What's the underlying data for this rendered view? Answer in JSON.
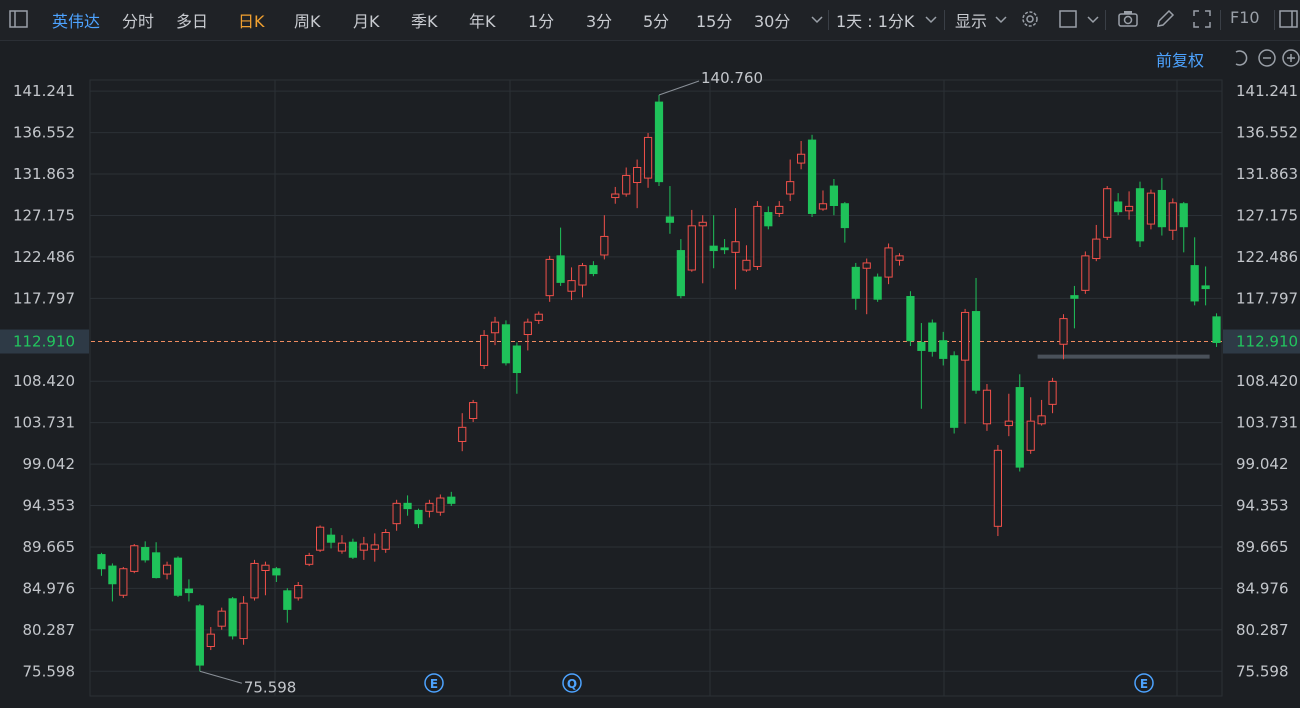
{
  "toolbar": {
    "stock_name": "英伟达",
    "periods": [
      "分时",
      "多日",
      "日K",
      "周K",
      "月K",
      "季K",
      "年K",
      "1分",
      "3分",
      "5分",
      "15分",
      "30分"
    ],
    "active_period": "日K",
    "combo_label": "1天 : 1分K",
    "display_label": "显示",
    "f10_label": "F10",
    "adjust_label": "前复权"
  },
  "colors": {
    "up": "#f0504a",
    "down": "#1fc25a",
    "price_line": "#f08c60",
    "grid": "#2b3036",
    "price_box": "#2e3a46",
    "price_text": "#22c55e"
  },
  "icons": [
    "chevron-down-icon",
    "settings-icon",
    "square-icon",
    "camera-icon",
    "pencil-icon",
    "fullscreen-icon",
    "sidebar-toggle-icon",
    "undo-icon",
    "zoom-out-icon",
    "zoom-in-icon"
  ],
  "chart_data": {
    "type": "candlestick",
    "ylim": [
      72.8,
      142.5
    ],
    "y_ticks": [
      "141.241",
      "136.552",
      "131.863",
      "127.175",
      "122.486",
      "117.797",
      "112.910",
      "108.420",
      "103.731",
      "99.042",
      "94.353",
      "89.665",
      "84.976",
      "80.287",
      "75.598"
    ],
    "current_price": "112.910",
    "high_label": "140.760",
    "low_label": "75.598",
    "event_markers": [
      "E",
      "Q",
      "E"
    ],
    "candles": [
      {
        "o": 88.8,
        "c": 87.2,
        "h": 89.0,
        "l": 86.4
      },
      {
        "o": 87.5,
        "c": 85.5,
        "h": 87.8,
        "l": 83.5
      },
      {
        "o": 84.2,
        "c": 87.2,
        "h": 87.4,
        "l": 83.9
      },
      {
        "o": 86.9,
        "c": 89.8,
        "h": 90.0,
        "l": 86.7
      },
      {
        "o": 89.6,
        "c": 88.2,
        "h": 90.3,
        "l": 87.9
      },
      {
        "o": 89.0,
        "c": 86.2,
        "h": 90.2,
        "l": 86.1
      },
      {
        "o": 86.6,
        "c": 87.6,
        "h": 88.0,
        "l": 86.0
      },
      {
        "o": 88.4,
        "c": 84.2,
        "h": 88.6,
        "l": 84.0
      },
      {
        "o": 84.9,
        "c": 84.5,
        "h": 86.0,
        "l": 83.5
      },
      {
        "o": 83.0,
        "c": 76.3,
        "h": 83.2,
        "l": 75.6
      },
      {
        "o": 78.4,
        "c": 79.8,
        "h": 80.6,
        "l": 78.0
      },
      {
        "o": 80.7,
        "c": 82.4,
        "h": 82.8,
        "l": 80.3
      },
      {
        "o": 83.8,
        "c": 79.6,
        "h": 84.0,
        "l": 79.2
      },
      {
        "o": 79.3,
        "c": 83.3,
        "h": 84.1,
        "l": 78.6
      },
      {
        "o": 83.9,
        "c": 87.8,
        "h": 88.2,
        "l": 83.6
      },
      {
        "o": 87.0,
        "c": 87.6,
        "h": 88.0,
        "l": 84.2
      },
      {
        "o": 87.2,
        "c": 86.5,
        "h": 87.4,
        "l": 85.7
      },
      {
        "o": 84.7,
        "c": 82.6,
        "h": 85.0,
        "l": 81.1
      },
      {
        "o": 83.9,
        "c": 85.3,
        "h": 85.7,
        "l": 83.6
      },
      {
        "o": 87.7,
        "c": 88.7,
        "h": 89.0,
        "l": 87.5
      },
      {
        "o": 89.3,
        "c": 91.9,
        "h": 92.1,
        "l": 89.1
      },
      {
        "o": 91.0,
        "c": 90.2,
        "h": 91.8,
        "l": 89.5
      },
      {
        "o": 89.2,
        "c": 90.1,
        "h": 91.0,
        "l": 88.9
      },
      {
        "o": 90.2,
        "c": 88.5,
        "h": 90.6,
        "l": 88.3
      },
      {
        "o": 89.3,
        "c": 90.0,
        "h": 90.8,
        "l": 88.2
      },
      {
        "o": 89.4,
        "c": 89.9,
        "h": 91.2,
        "l": 88.0
      },
      {
        "o": 89.4,
        "c": 91.3,
        "h": 91.7,
        "l": 89.0
      },
      {
        "o": 92.3,
        "c": 94.6,
        "h": 95.0,
        "l": 91.5
      },
      {
        "o": 94.6,
        "c": 94.0,
        "h": 95.5,
        "l": 93.2
      },
      {
        "o": 93.8,
        "c": 92.3,
        "h": 94.0,
        "l": 91.8
      },
      {
        "o": 93.7,
        "c": 94.6,
        "h": 95.0,
        "l": 93.0
      },
      {
        "o": 93.6,
        "c": 95.2,
        "h": 95.6,
        "l": 93.2
      },
      {
        "o": 95.3,
        "c": 94.6,
        "h": 95.9,
        "l": 94.3
      },
      {
        "o": 101.6,
        "c": 103.2,
        "h": 104.8,
        "l": 100.5
      },
      {
        "o": 104.2,
        "c": 106.0,
        "h": 106.3,
        "l": 103.8
      },
      {
        "o": 110.2,
        "c": 113.6,
        "h": 114.2,
        "l": 109.8
      },
      {
        "o": 113.9,
        "c": 115.1,
        "h": 115.7,
        "l": 112.5
      },
      {
        "o": 114.8,
        "c": 110.5,
        "h": 115.3,
        "l": 110.2
      },
      {
        "o": 112.4,
        "c": 109.4,
        "h": 112.8,
        "l": 107.0
      },
      {
        "o": 113.7,
        "c": 115.1,
        "h": 115.5,
        "l": 111.9
      },
      {
        "o": 115.3,
        "c": 116.0,
        "h": 116.3,
        "l": 114.9
      },
      {
        "o": 118.1,
        "c": 122.2,
        "h": 122.6,
        "l": 117.4
      },
      {
        "o": 122.6,
        "c": 119.6,
        "h": 125.8,
        "l": 119.2
      },
      {
        "o": 118.6,
        "c": 119.8,
        "h": 121.3,
        "l": 117.6
      },
      {
        "o": 119.3,
        "c": 121.5,
        "h": 121.8,
        "l": 117.9
      },
      {
        "o": 121.5,
        "c": 120.6,
        "h": 122.0,
        "l": 120.3
      },
      {
        "o": 122.7,
        "c": 124.8,
        "h": 127.2,
        "l": 122.2
      },
      {
        "o": 129.2,
        "c": 129.6,
        "h": 130.4,
        "l": 128.5
      },
      {
        "o": 129.6,
        "c": 131.7,
        "h": 132.6,
        "l": 129.3
      },
      {
        "o": 130.9,
        "c": 132.6,
        "h": 133.5,
        "l": 128.0
      },
      {
        "o": 131.4,
        "c": 136.0,
        "h": 136.5,
        "l": 130.3
      },
      {
        "o": 140.0,
        "c": 131.0,
        "h": 140.8,
        "l": 130.5
      },
      {
        "o": 127.0,
        "c": 126.4,
        "h": 130.5,
        "l": 125.1
      },
      {
        "o": 123.2,
        "c": 118.1,
        "h": 124.5,
        "l": 117.8
      },
      {
        "o": 121.0,
        "c": 126.0,
        "h": 127.8,
        "l": 120.8
      },
      {
        "o": 126.0,
        "c": 126.4,
        "h": 127.2,
        "l": 119.5
      },
      {
        "o": 123.7,
        "c": 123.2,
        "h": 127.2,
        "l": 121.2
      },
      {
        "o": 123.5,
        "c": 123.3,
        "h": 124.5,
        "l": 122.8
      },
      {
        "o": 123.0,
        "c": 124.2,
        "h": 128.0,
        "l": 118.8
      },
      {
        "o": 121.0,
        "c": 122.1,
        "h": 123.8,
        "l": 120.8
      },
      {
        "o": 121.4,
        "c": 128.2,
        "h": 128.8,
        "l": 121.0
      },
      {
        "o": 127.5,
        "c": 126.0,
        "h": 128.2,
        "l": 125.6
      },
      {
        "o": 127.4,
        "c": 128.2,
        "h": 128.8,
        "l": 127.0
      },
      {
        "o": 129.6,
        "c": 131.0,
        "h": 133.5,
        "l": 128.8
      },
      {
        "o": 133.1,
        "c": 134.1,
        "h": 135.6,
        "l": 132.4
      },
      {
        "o": 135.7,
        "c": 127.4,
        "h": 136.3,
        "l": 127.0
      },
      {
        "o": 127.9,
        "c": 128.5,
        "h": 130.0,
        "l": 127.7
      },
      {
        "o": 130.5,
        "c": 128.3,
        "h": 131.3,
        "l": 127.2
      },
      {
        "o": 128.5,
        "c": 125.8,
        "h": 128.7,
        "l": 124.1
      },
      {
        "o": 121.3,
        "c": 117.8,
        "h": 121.8,
        "l": 116.5
      },
      {
        "o": 121.2,
        "c": 121.8,
        "h": 122.3,
        "l": 116.0
      },
      {
        "o": 120.2,
        "c": 117.7,
        "h": 120.6,
        "l": 117.4
      },
      {
        "o": 120.2,
        "c": 123.5,
        "h": 124.0,
        "l": 119.4
      },
      {
        "o": 122.1,
        "c": 122.6,
        "h": 122.9,
        "l": 121.5
      },
      {
        "o": 118.0,
        "c": 113.0,
        "h": 118.6,
        "l": 112.4
      },
      {
        "o": 112.8,
        "c": 111.9,
        "h": 115.0,
        "l": 105.3
      },
      {
        "o": 115.0,
        "c": 111.8,
        "h": 115.4,
        "l": 111.2
      },
      {
        "o": 113.0,
        "c": 111.0,
        "h": 114.0,
        "l": 110.2
      },
      {
        "o": 111.3,
        "c": 103.2,
        "h": 111.8,
        "l": 102.5
      },
      {
        "o": 110.8,
        "c": 116.2,
        "h": 116.6,
        "l": 103.6
      },
      {
        "o": 116.3,
        "c": 107.4,
        "h": 120.1,
        "l": 107.0
      },
      {
        "o": 103.6,
        "c": 107.4,
        "h": 108.1,
        "l": 102.8
      },
      {
        "o": 92.0,
        "c": 100.6,
        "h": 101.2,
        "l": 90.9
      },
      {
        "o": 103.4,
        "c": 103.9,
        "h": 107.0,
        "l": 102.2
      },
      {
        "o": 107.7,
        "c": 98.7,
        "h": 109.2,
        "l": 98.2
      },
      {
        "o": 100.6,
        "c": 103.9,
        "h": 106.6,
        "l": 100.2
      },
      {
        "o": 103.6,
        "c": 104.5,
        "h": 106.3,
        "l": 103.4
      },
      {
        "o": 105.8,
        "c": 108.4,
        "h": 108.8,
        "l": 104.8
      },
      {
        "o": 112.6,
        "c": 115.5,
        "h": 116.0,
        "l": 110.9
      },
      {
        "o": 118.1,
        "c": 117.8,
        "h": 119.2,
        "l": 114.4
      },
      {
        "o": 118.7,
        "c": 122.6,
        "h": 123.1,
        "l": 118.3
      },
      {
        "o": 122.3,
        "c": 124.5,
        "h": 126.1,
        "l": 122.0
      },
      {
        "o": 124.7,
        "c": 130.2,
        "h": 130.5,
        "l": 124.4
      },
      {
        "o": 128.7,
        "c": 127.6,
        "h": 129.7,
        "l": 127.2
      },
      {
        "o": 127.7,
        "c": 128.2,
        "h": 129.9,
        "l": 126.7
      },
      {
        "o": 130.2,
        "c": 124.3,
        "h": 131.0,
        "l": 123.6
      },
      {
        "o": 126.2,
        "c": 129.7,
        "h": 130.1,
        "l": 125.6
      },
      {
        "o": 130.0,
        "c": 125.9,
        "h": 131.4,
        "l": 124.9
      },
      {
        "o": 125.5,
        "c": 128.6,
        "h": 129.1,
        "l": 124.4
      },
      {
        "o": 128.5,
        "c": 125.9,
        "h": 128.7,
        "l": 123.0
      },
      {
        "o": 121.5,
        "c": 117.5,
        "h": 124.7,
        "l": 117.0
      },
      {
        "o": 119.2,
        "c": 118.9,
        "h": 121.4,
        "l": 117.0
      },
      {
        "o": 115.7,
        "c": 112.8,
        "h": 116.1,
        "l": 112.3
      }
    ]
  }
}
